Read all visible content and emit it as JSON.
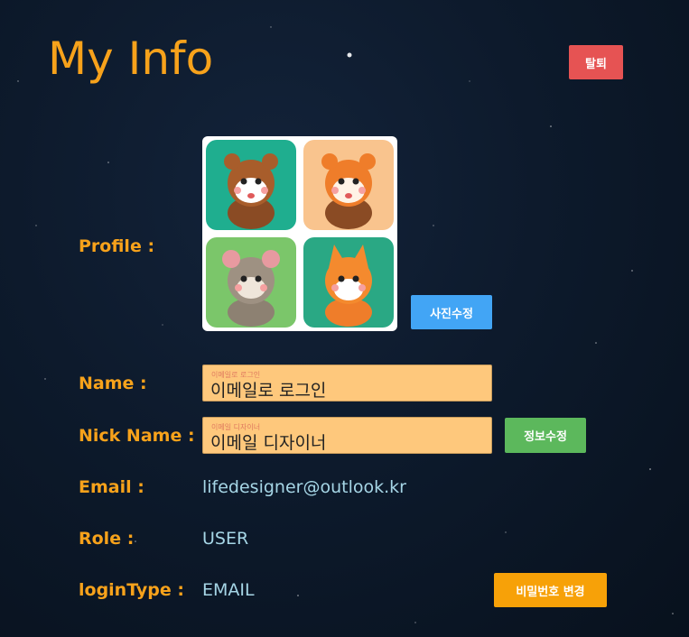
{
  "header": {
    "title": "My Info",
    "withdraw_label": "탈퇴"
  },
  "profile": {
    "label": "Profile :",
    "edit_photo_label": "사진수정"
  },
  "name": {
    "label": "Name :",
    "value": "이메일로 로그인",
    "placeholder": "이메일로 로그인"
  },
  "nickname": {
    "label": "Nick Name :",
    "value": "이메일 디자이너",
    "placeholder": "이메일 디자이너",
    "save_label": "정보수정"
  },
  "email": {
    "label": "Email :",
    "value": "lifedesigner@outlook.kr"
  },
  "role": {
    "label": "Role :",
    "value": "USER"
  },
  "login_type": {
    "label": "loginType :",
    "value": "EMAIL",
    "change_password_label": "비밀번호 변경"
  },
  "colors": {
    "accent": "#f7a21b",
    "value_text": "#a6d6e6",
    "withdraw": "#e65353",
    "photo_edit": "#42a5f5",
    "info_edit": "#5cb85c",
    "password_change": "#f7a108",
    "field_bg": "#fec87c"
  },
  "icons": [
    "profile-animal-grid-icon"
  ]
}
